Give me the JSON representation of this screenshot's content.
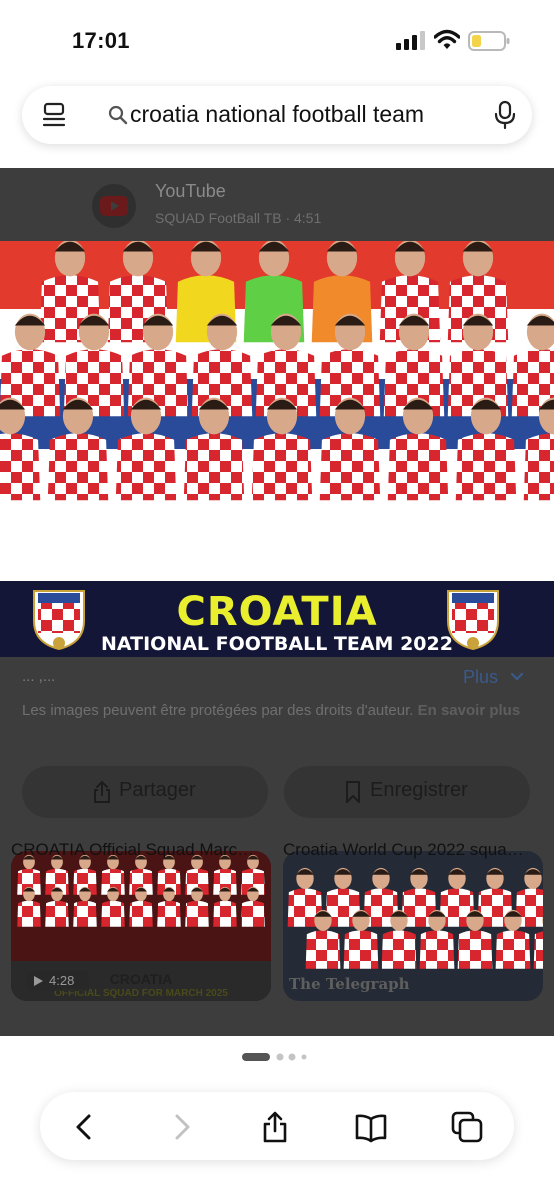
{
  "status_bar": {
    "time": "17:01"
  },
  "search": {
    "query": "croatia national football team"
  },
  "result": {
    "source_name": "YouTube",
    "source_meta": "SQUAD FootBall TB · 4:51",
    "banner_title": "CROATIA",
    "banner_subtitle": "NATIONAL FOOTBALL TEAM 2022",
    "crest_text": "HNS",
    "caption": "... ,...",
    "more_label": "Plus",
    "copyright_text": "Les images peuvent être protégées par des droits d'auteur.",
    "copyright_link": "En savoir plus",
    "share_label": "Partager",
    "save_label": "Enregistrer"
  },
  "related": [
    {
      "title": "CROATIA Official Squad Marc…",
      "duration": "4:28",
      "overlay_title": "CROATIA",
      "overlay_subtitle": "OFFICIAL SQUAD FOR MARCH 2025"
    },
    {
      "title": "Croatia World Cup 2022 squa…",
      "watermark": "The Telegraph"
    }
  ],
  "pager": {
    "count": 4,
    "active": 0
  },
  "toolbar": {
    "icons": [
      "back-icon",
      "forward-icon",
      "share-icon",
      "bookmarks-icon",
      "tabs-icon"
    ]
  },
  "colors": {
    "banner_background": "#141637",
    "banner_title": "#e9ef2f",
    "croatia_red": "#d8262e",
    "link_blue": "#3a5a8c",
    "overlay_dim": "#3d3d3d"
  }
}
